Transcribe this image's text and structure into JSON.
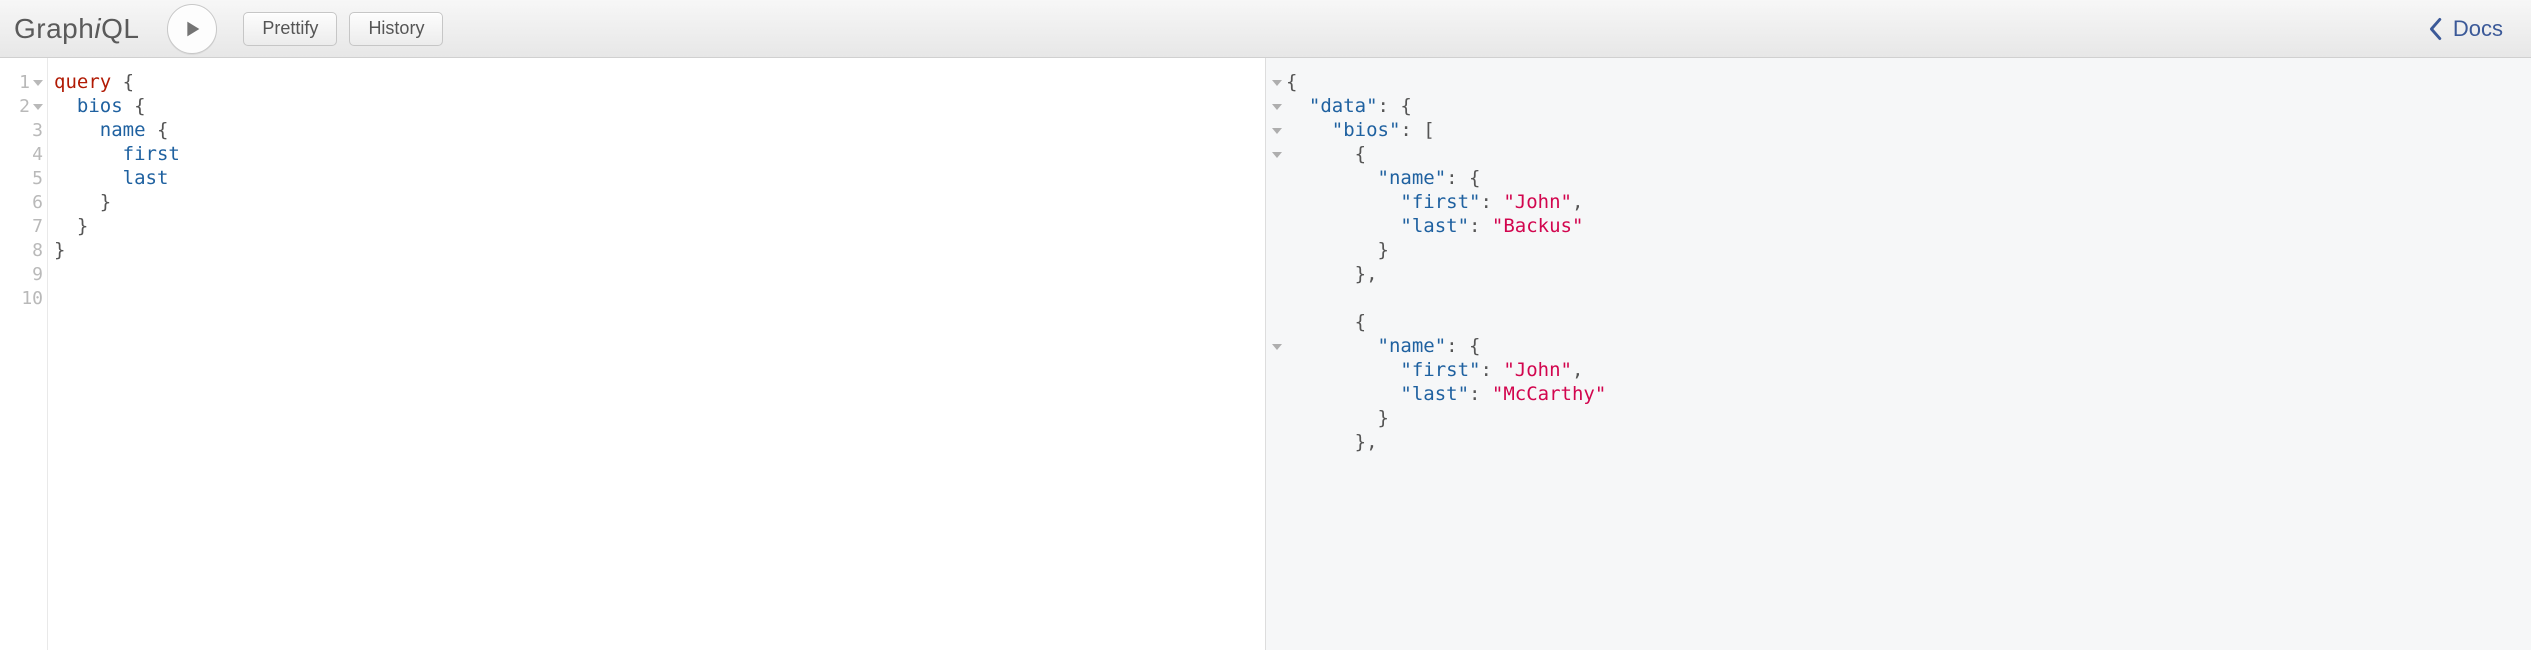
{
  "app": {
    "logo_a": "Graph",
    "logo_i": "i",
    "logo_b": "QL"
  },
  "toolbar": {
    "prettify": "Prettify",
    "history": "History",
    "docs": "Docs"
  },
  "editor": {
    "line_count": 10,
    "foldable_lines": [
      1,
      2
    ],
    "tokens": [
      [
        {
          "t": "query",
          "c": "kw"
        },
        {
          "t": " {",
          "c": "pn"
        }
      ],
      [
        {
          "t": "  ",
          "c": "pn"
        },
        {
          "t": "bios",
          "c": "def"
        },
        {
          "t": " {",
          "c": "pn"
        }
      ],
      [
        {
          "t": "    ",
          "c": "pn"
        },
        {
          "t": "name",
          "c": "def"
        },
        {
          "t": " {",
          "c": "pn"
        }
      ],
      [
        {
          "t": "      ",
          "c": "pn"
        },
        {
          "t": "first",
          "c": "def"
        }
      ],
      [
        {
          "t": "      ",
          "c": "pn"
        },
        {
          "t": "last",
          "c": "def"
        }
      ],
      [
        {
          "t": "    }",
          "c": "pn"
        }
      ],
      [
        {
          "t": "  }",
          "c": "pn"
        }
      ],
      [
        {
          "t": "}",
          "c": "pn"
        }
      ],
      [],
      []
    ]
  },
  "result": {
    "fold_rows": [
      1,
      2,
      3,
      4,
      12
    ],
    "tokens": [
      [
        {
          "t": "{",
          "c": "pn"
        }
      ],
      [
        {
          "t": "  ",
          "c": "pn"
        },
        {
          "t": "\"data\"",
          "c": "prop"
        },
        {
          "t": ": {",
          "c": "pn"
        }
      ],
      [
        {
          "t": "    ",
          "c": "pn"
        },
        {
          "t": "\"bios\"",
          "c": "prop"
        },
        {
          "t": ": [",
          "c": "pn"
        }
      ],
      [
        {
          "t": "      {",
          "c": "pn"
        }
      ],
      [
        {
          "t": "        ",
          "c": "pn"
        },
        {
          "t": "\"name\"",
          "c": "prop"
        },
        {
          "t": ": {",
          "c": "pn"
        }
      ],
      [
        {
          "t": "          ",
          "c": "pn"
        },
        {
          "t": "\"first\"",
          "c": "prop"
        },
        {
          "t": ": ",
          "c": "pn"
        },
        {
          "t": "\"John\"",
          "c": "str"
        },
        {
          "t": ",",
          "c": "pn"
        }
      ],
      [
        {
          "t": "          ",
          "c": "pn"
        },
        {
          "t": "\"last\"",
          "c": "prop"
        },
        {
          "t": ": ",
          "c": "pn"
        },
        {
          "t": "\"Backus\"",
          "c": "str"
        }
      ],
      [
        {
          "t": "        }",
          "c": "pn"
        }
      ],
      [
        {
          "t": "      },",
          "c": "pn"
        }
      ],
      [],
      [
        {
          "t": "      {",
          "c": "pn"
        }
      ],
      [
        {
          "t": "        ",
          "c": "pn"
        },
        {
          "t": "\"name\"",
          "c": "prop"
        },
        {
          "t": ": {",
          "c": "pn"
        }
      ],
      [
        {
          "t": "          ",
          "c": "pn"
        },
        {
          "t": "\"first\"",
          "c": "prop"
        },
        {
          "t": ": ",
          "c": "pn"
        },
        {
          "t": "\"John\"",
          "c": "str"
        },
        {
          "t": ",",
          "c": "pn"
        }
      ],
      [
        {
          "t": "          ",
          "c": "pn"
        },
        {
          "t": "\"last\"",
          "c": "prop"
        },
        {
          "t": ": ",
          "c": "pn"
        },
        {
          "t": "\"McCarthy\"",
          "c": "str"
        }
      ],
      [
        {
          "t": "        }",
          "c": "pn"
        }
      ],
      [
        {
          "t": "      },",
          "c": "pn"
        }
      ]
    ]
  }
}
